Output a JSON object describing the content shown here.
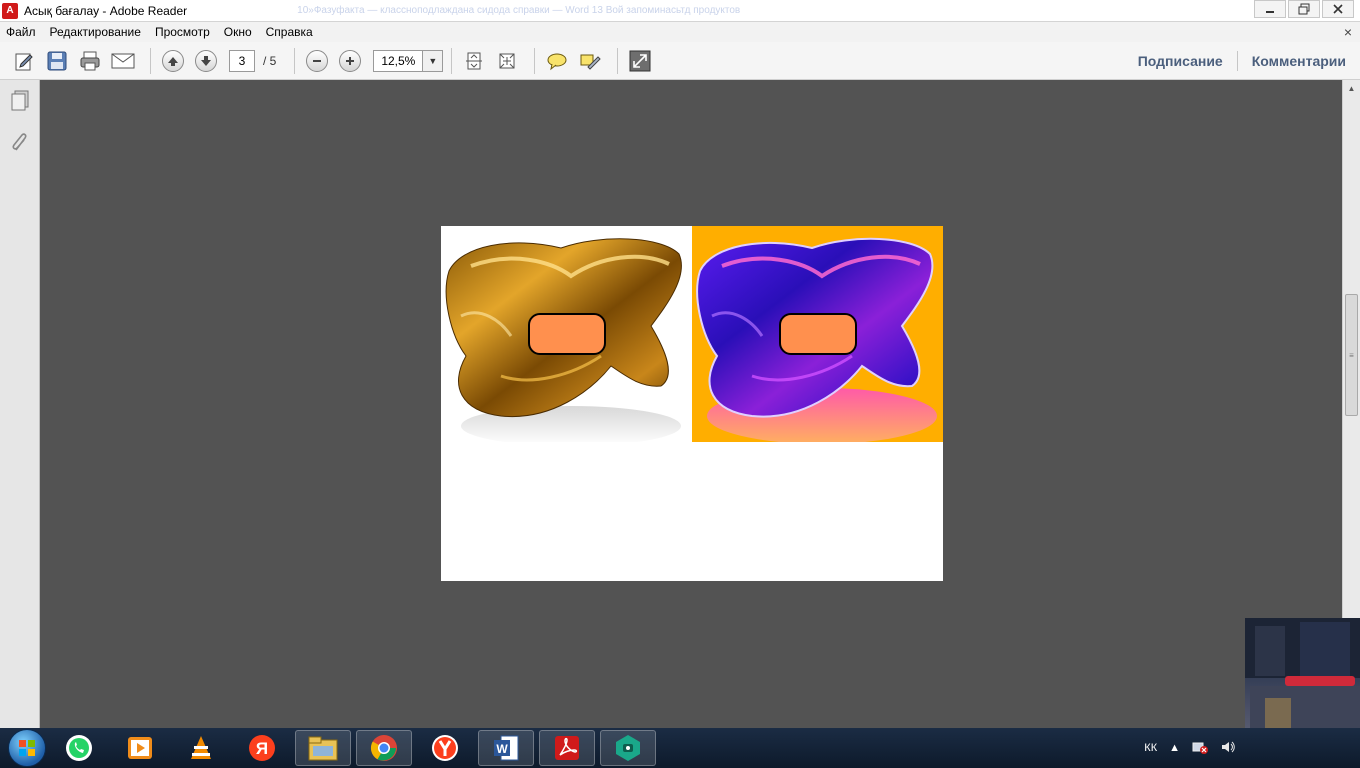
{
  "window": {
    "title": "Асық бағалау - Adobe Reader",
    "faded_title": "10»Фазуфакта — классноподлаждана сидода справки — Word 13 Вой запоминасьтд продуктов"
  },
  "menu": {
    "items": [
      "Файл",
      "Редактирование",
      "Просмотр",
      "Окно",
      "Справка"
    ]
  },
  "toolbar": {
    "page_current": "3",
    "page_total": "/ 5",
    "zoom": "12,5%",
    "sign_label": "Подписание",
    "comment_label": "Комментарии"
  },
  "tray": {
    "lang": "КК"
  },
  "colors": {
    "label_fill": "#ff904e",
    "purple_bg": "#ffae00",
    "doc_bg": "#535353"
  },
  "icons": {
    "toolbar": [
      "edit-icon",
      "save-icon",
      "print-icon",
      "email-icon",
      "page-up-icon",
      "page-down-icon",
      "zoom-out-icon",
      "zoom-in-icon",
      "fit-page-icon",
      "fit-width-icon",
      "comment-icon",
      "highlight-icon",
      "fullscreen-icon"
    ],
    "taskbar": [
      "whatsapp-icon",
      "media-player-icon",
      "vlc-icon",
      "yandex-icon",
      "file-explorer-icon",
      "chrome-icon",
      "yandex-browser-icon",
      "word-icon",
      "acrobat-icon",
      "app-icon"
    ]
  }
}
